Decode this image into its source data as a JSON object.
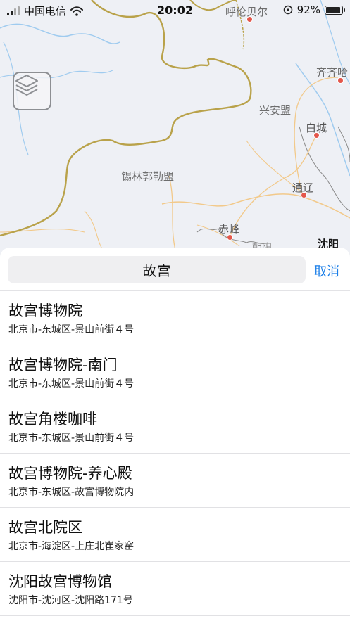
{
  "status_bar": {
    "carrier": "中国电信",
    "time": "20:02",
    "battery": "92%"
  },
  "map": {
    "labels": {
      "hulunbeier": "呼伦贝尔",
      "qiqihar": "齐齐哈",
      "xinganmeng": "兴安盟",
      "baicheng": "白城",
      "xilinguole": "锡林郭勒盟",
      "tongliao": "通辽",
      "chifeng": "赤峰",
      "chaoyang": "朝阳",
      "shenyang": "沈阳"
    }
  },
  "search": {
    "query": "故宫",
    "cancel_label": "取消"
  },
  "results": [
    {
      "title": "故宫博物院",
      "address": "北京市-东城区-景山前街４号"
    },
    {
      "title": "故宫博物院-南门",
      "address": "北京市-东城区-景山前街４号"
    },
    {
      "title": "故宫角楼咖啡",
      "address": "北京市-东城区-景山前街４号"
    },
    {
      "title": "故宫博物院-养心殿",
      "address": "北京市-东城区-故宫博物院内"
    },
    {
      "title": "故宫北院区",
      "address": "北京市-海淀区-上庄北崔家窑"
    },
    {
      "title": "沈阳故宫博物馆",
      "address": "沈阳市-沈河区-沈阳路171号"
    }
  ],
  "colors": {
    "accent": "#1a7ee8",
    "border_line": "#b9a24a",
    "road": "#f2c98a",
    "river": "#9fcbef",
    "city_dot": "#e4574b"
  },
  "icons": {
    "layers": "layers-icon",
    "wifi": "wifi-icon",
    "orientation_lock": "orientation-lock-icon",
    "battery": "battery-icon"
  }
}
